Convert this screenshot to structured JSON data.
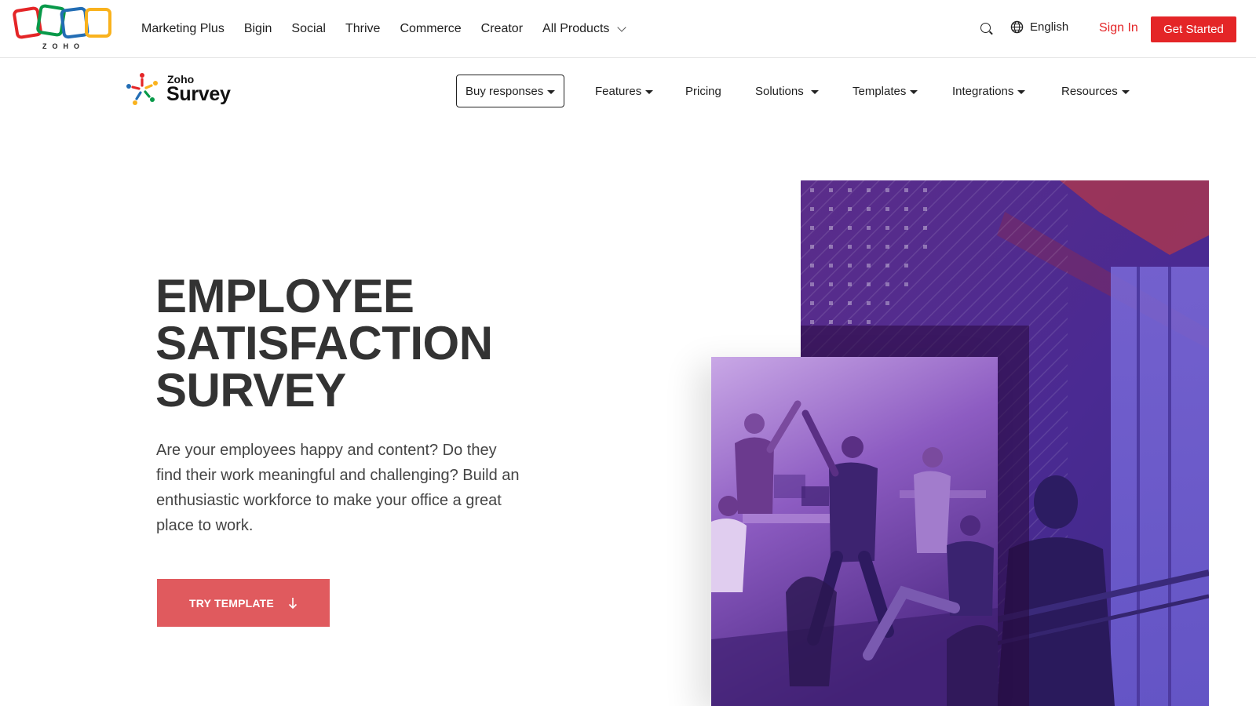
{
  "topbar": {
    "logo_text": "ZOHO",
    "nav": [
      "Marketing Plus",
      "Bigin",
      "Social",
      "Thrive",
      "Commerce",
      "Creator",
      "All Products"
    ],
    "all_products_icon": "chevron-down-icon",
    "search_icon": "search-icon",
    "language_icon": "globe-icon",
    "language": "English",
    "sign_in": "Sign In",
    "get_started": "Get Started",
    "accent_color": "#e42527"
  },
  "product_nav": {
    "logo_zoho": "Zoho",
    "logo_name": "Survey",
    "items": [
      "Buy responses",
      "Features",
      "Pricing",
      "Solutions",
      "Templates",
      "Integrations",
      "Resources"
    ]
  },
  "hero": {
    "title_lines": [
      "EMPLOYEE",
      "SATISFACTION",
      "SURVEY"
    ],
    "description": "Are your employees happy and content? Do they find their work meaningful and challenging? Build an enthusiastic workforce to make your office a great place to work.",
    "cta": "TRY TEMPLATE",
    "cta_icon": "arrow-down-icon",
    "cta_color": "#e05a5e",
    "image_tint": "#6a3fb0"
  }
}
